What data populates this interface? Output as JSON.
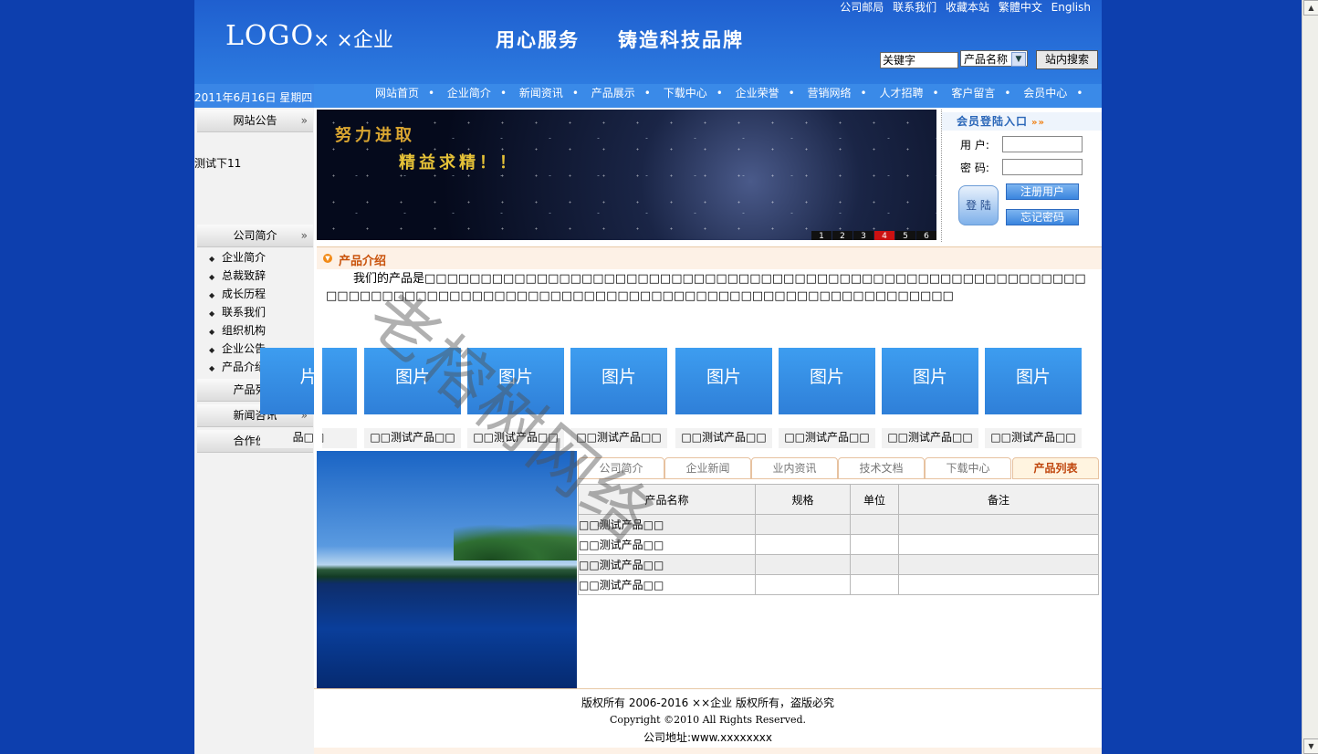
{
  "header": {
    "toplinks": [
      "公司邮局",
      "联系我们",
      "收藏本站",
      "繁體中文",
      "English"
    ],
    "logo": "LOGO",
    "company": "× ×企业",
    "slogan1": "用心服务",
    "slogan2": "铸造科技品牌",
    "search": {
      "value": "关键字",
      "select_value": "产品名称",
      "button": "站内搜索"
    }
  },
  "date": "2011年6月16日 星期四",
  "nav": [
    "网站首页",
    "企业简介",
    "新闻资讯",
    "产品展示",
    "下载中心",
    "企业荣誉",
    "营销网络",
    "人才招聘",
    "客户留言",
    "会员中心"
  ],
  "sidebar": {
    "notice_title": "网站公告",
    "notice_text": "测试下11",
    "about_title": "公司简介",
    "about_items": [
      "企业简介",
      "总裁致辞",
      "成长历程",
      "联系我们",
      "组织机构",
      "企业公告",
      "产品介绍"
    ],
    "products_title": "产品列表",
    "news_title": "新闻咨讯",
    "partners_title": "合作伙伴"
  },
  "banner": {
    "line1": "努力进取",
    "line2": "精益求精！！",
    "pages": [
      "1",
      "2",
      "3",
      "4",
      "5",
      "6"
    ],
    "active_page": "4"
  },
  "login": {
    "title": "会员登陆入口",
    "user_label": "用 户:",
    "pass_label": "密 码:",
    "login_button": "登 陆",
    "register_button": "注册用户",
    "forgot_button": "忘记密码"
  },
  "intro": {
    "title": "产品介绍",
    "text": "我们的产品是□□□□□□□□□□□□□□□□□□□□□□□□□□□□□□□□□□□□□□□□□□□□□□□□□□□□□□□□□□□□□□□□□□□□□□□□□□□□□□□□□□□□□□□□□□□□□□□□□□□□□□□□□□□□□□□□□□□"
  },
  "products": [
    {
      "image": "片",
      "caption": "品□□"
    },
    {
      "image": "图片",
      "caption": "□□测试产品□□"
    },
    {
      "image": "图片",
      "caption": "□□测试产品□□"
    },
    {
      "image": "图片",
      "caption": "□□测试产品□□"
    },
    {
      "image": "图片",
      "caption": "□□测试产品□□"
    },
    {
      "image": "图片",
      "caption": "□□测试产品□□"
    },
    {
      "image": "图片",
      "caption": "□□测试产品□□"
    },
    {
      "image": "图片",
      "caption": "□□测试产品□□"
    }
  ],
  "tabs": [
    "公司简介",
    "企业新闻",
    "业内资讯",
    "技术文档",
    "下载中心",
    "产品列表"
  ],
  "active_tab": "产品列表",
  "table": {
    "headers": [
      "产品名称",
      "规格",
      "单位",
      "备注"
    ],
    "rows": [
      [
        "□□测试产品□□",
        "",
        "",
        ""
      ],
      [
        "□□测试产品□□",
        "",
        "",
        ""
      ],
      [
        "□□测试产品□□",
        "",
        "",
        ""
      ],
      [
        "□□测试产品□□",
        "",
        "",
        ""
      ]
    ]
  },
  "footer": {
    "line1": "版权所有 2006-2016 ××企业 版权所有，盗版必究",
    "line2": "Copyright ©2010 All Rights Reserved.",
    "line3": "公司地址:www.xxxxxxxx"
  },
  "watermark": "老榕树网络",
  "colors": {
    "background": "#0d3fae",
    "header": "#2d7be0",
    "nav": "#3a8ae8",
    "accent": "#c9530c"
  }
}
